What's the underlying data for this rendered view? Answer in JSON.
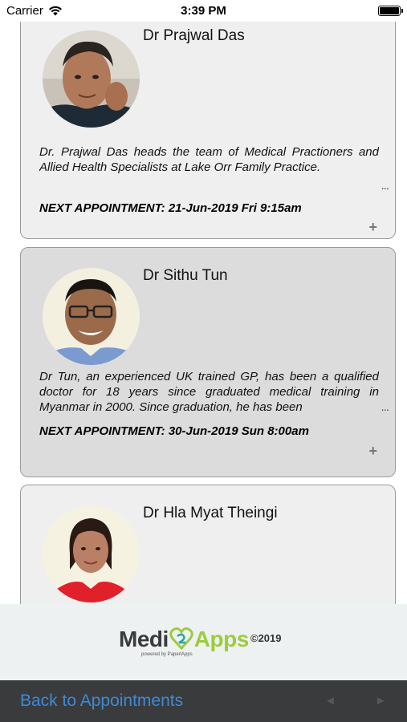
{
  "status_bar": {
    "carrier": "Carrier",
    "time": "3:39 PM",
    "battery_level": 1.0
  },
  "doctors": [
    {
      "name": "Dr Prajwal Das",
      "description": "Dr. Prajwal Das heads the team of Medical Practioners and Allied Health Specialists at Lake Orr Family Practice.",
      "more": "...",
      "next_appointment": "NEXT APPOINTMENT: 21-Jun-2019 Fri 9:15am",
      "expand": "+"
    },
    {
      "name": "Dr Sithu Tun",
      "description": "Dr Tun, an experienced UK trained GP, has been a qualified doctor for 18 years since graduated medical training in Myanmar in 2000. Since graduation, he has been",
      "more": "...",
      "next_appointment": "NEXT APPOINTMENT: 30-Jun-2019 Sun 8:00am",
      "expand": "+"
    },
    {
      "name": "Dr Hla Myat Theingi"
    }
  ],
  "footer": {
    "logo_medi": "Medi",
    "logo_apps": "Apps",
    "logo_sub": "powered by PaperlApps",
    "copyright": "©2019"
  },
  "toolbar": {
    "back_label": "Back to Appointments",
    "prev_symbol": "◄",
    "next_symbol": "►"
  },
  "colors": {
    "link_blue": "#3d8bd8",
    "toolbar_bg": "#3a3b3d",
    "logo_green": "#9ccc3c"
  }
}
